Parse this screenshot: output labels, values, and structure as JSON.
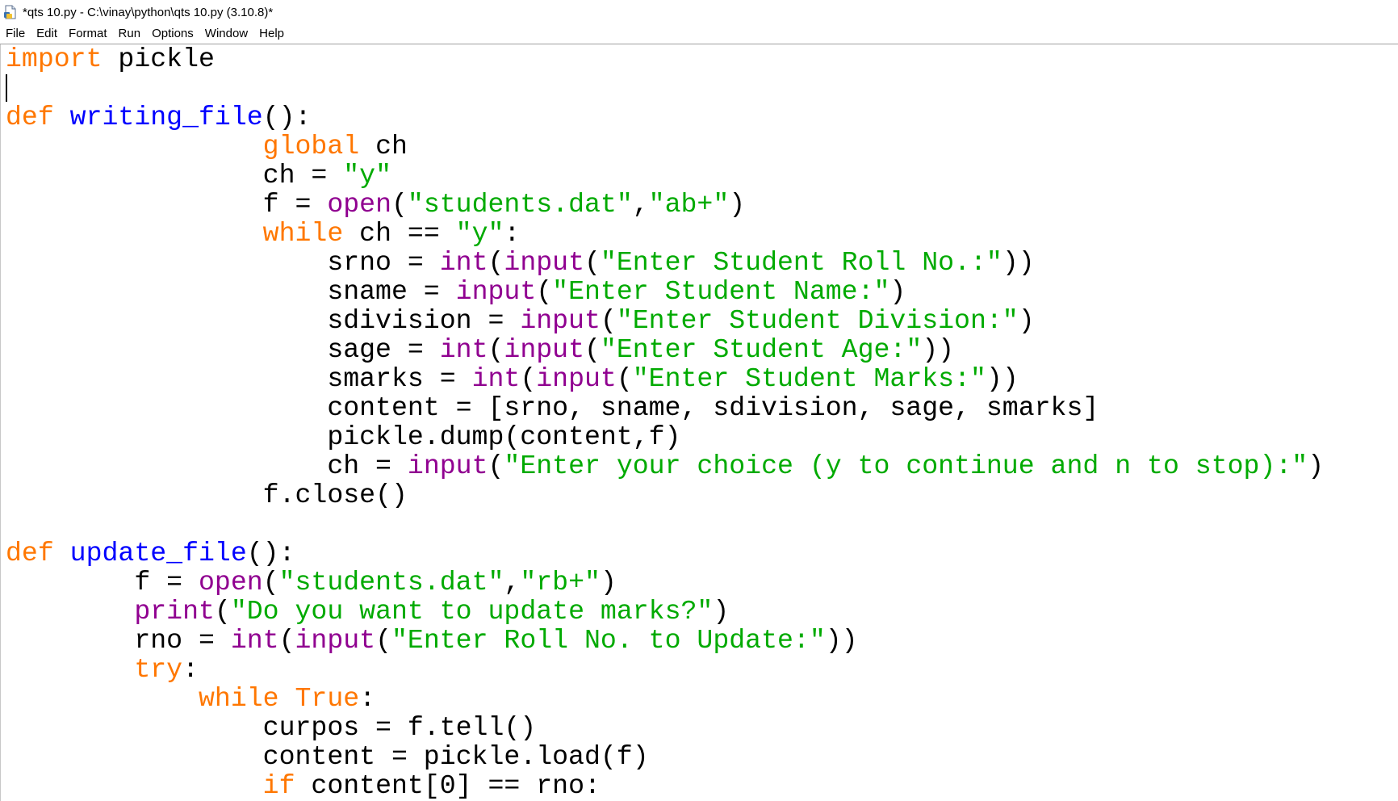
{
  "window": {
    "title": "*qts 10.py - C:\\vinay\\python\\qts 10.py (3.10.8)*",
    "icon": "python-file-icon"
  },
  "menu": [
    "File",
    "Edit",
    "Format",
    "Run",
    "Options",
    "Window",
    "Help"
  ],
  "colors": {
    "keyword": "#ff7700",
    "builtin": "#900090",
    "string": "#00aa00",
    "definition": "#0000ff",
    "plain": "#000000"
  },
  "code_lines": [
    [
      [
        "kw",
        "import"
      ],
      [
        "pl",
        " pickle"
      ]
    ],
    [],
    [
      [
        "kw",
        "def"
      ],
      [
        "pl",
        " "
      ],
      [
        "df",
        "writing_file"
      ],
      [
        "pl",
        "():"
      ]
    ],
    [
      [
        "pl",
        "                "
      ],
      [
        "kw",
        "global"
      ],
      [
        "pl",
        " ch"
      ]
    ],
    [
      [
        "pl",
        "                ch = "
      ],
      [
        "st",
        "\"y\""
      ]
    ],
    [
      [
        "pl",
        "                f = "
      ],
      [
        "bi",
        "open"
      ],
      [
        "pl",
        "("
      ],
      [
        "st",
        "\"students.dat\""
      ],
      [
        "pl",
        ","
      ],
      [
        "st",
        "\"ab+\""
      ],
      [
        "pl",
        ")"
      ]
    ],
    [
      [
        "pl",
        "                "
      ],
      [
        "kw",
        "while"
      ],
      [
        "pl",
        " ch == "
      ],
      [
        "st",
        "\"y\""
      ],
      [
        "pl",
        ":"
      ]
    ],
    [
      [
        "pl",
        "                    srno = "
      ],
      [
        "bi",
        "int"
      ],
      [
        "pl",
        "("
      ],
      [
        "bi",
        "input"
      ],
      [
        "pl",
        "("
      ],
      [
        "st",
        "\"Enter Student Roll No.:\""
      ],
      [
        "pl",
        "))"
      ]
    ],
    [
      [
        "pl",
        "                    sname = "
      ],
      [
        "bi",
        "input"
      ],
      [
        "pl",
        "("
      ],
      [
        "st",
        "\"Enter Student Name:\""
      ],
      [
        "pl",
        ")"
      ]
    ],
    [
      [
        "pl",
        "                    sdivision = "
      ],
      [
        "bi",
        "input"
      ],
      [
        "pl",
        "("
      ],
      [
        "st",
        "\"Enter Student Division:\""
      ],
      [
        "pl",
        ")"
      ]
    ],
    [
      [
        "pl",
        "                    sage = "
      ],
      [
        "bi",
        "int"
      ],
      [
        "pl",
        "("
      ],
      [
        "bi",
        "input"
      ],
      [
        "pl",
        "("
      ],
      [
        "st",
        "\"Enter Student Age:\""
      ],
      [
        "pl",
        "))"
      ]
    ],
    [
      [
        "pl",
        "                    smarks = "
      ],
      [
        "bi",
        "int"
      ],
      [
        "pl",
        "("
      ],
      [
        "bi",
        "input"
      ],
      [
        "pl",
        "("
      ],
      [
        "st",
        "\"Enter Student Marks:\""
      ],
      [
        "pl",
        "))"
      ]
    ],
    [
      [
        "pl",
        "                    content = [srno, sname, sdivision, sage, smarks]"
      ]
    ],
    [
      [
        "pl",
        "                    pickle.dump(content,f)"
      ]
    ],
    [
      [
        "pl",
        "                    ch = "
      ],
      [
        "bi",
        "input"
      ],
      [
        "pl",
        "("
      ],
      [
        "st",
        "\"Enter your choice (y to continue and n to stop):\""
      ],
      [
        "pl",
        ")"
      ]
    ],
    [
      [
        "pl",
        "                f.close()"
      ]
    ],
    [],
    [
      [
        "kw",
        "def"
      ],
      [
        "pl",
        " "
      ],
      [
        "df",
        "update_file"
      ],
      [
        "pl",
        "():"
      ]
    ],
    [
      [
        "pl",
        "        f = "
      ],
      [
        "bi",
        "open"
      ],
      [
        "pl",
        "("
      ],
      [
        "st",
        "\"students.dat\""
      ],
      [
        "pl",
        ","
      ],
      [
        "st",
        "\"rb+\""
      ],
      [
        "pl",
        ")"
      ]
    ],
    [
      [
        "pl",
        "        "
      ],
      [
        "bi",
        "print"
      ],
      [
        "pl",
        "("
      ],
      [
        "st",
        "\"Do you want to update marks?\""
      ],
      [
        "pl",
        ")"
      ]
    ],
    [
      [
        "pl",
        "        rno = "
      ],
      [
        "bi",
        "int"
      ],
      [
        "pl",
        "("
      ],
      [
        "bi",
        "input"
      ],
      [
        "pl",
        "("
      ],
      [
        "st",
        "\"Enter Roll No. to Update:\""
      ],
      [
        "pl",
        "))"
      ]
    ],
    [
      [
        "pl",
        "        "
      ],
      [
        "kw",
        "try"
      ],
      [
        "pl",
        ":"
      ]
    ],
    [
      [
        "pl",
        "            "
      ],
      [
        "kw",
        "while"
      ],
      [
        "pl",
        " "
      ],
      [
        "kw",
        "True"
      ],
      [
        "pl",
        ":"
      ]
    ],
    [
      [
        "pl",
        "                curpos = f.tell()"
      ]
    ],
    [
      [
        "pl",
        "                content = pickle.load(f)"
      ]
    ],
    [
      [
        "pl",
        "                "
      ],
      [
        "kw",
        "if"
      ],
      [
        "pl",
        " content[0] == rno:"
      ]
    ]
  ]
}
